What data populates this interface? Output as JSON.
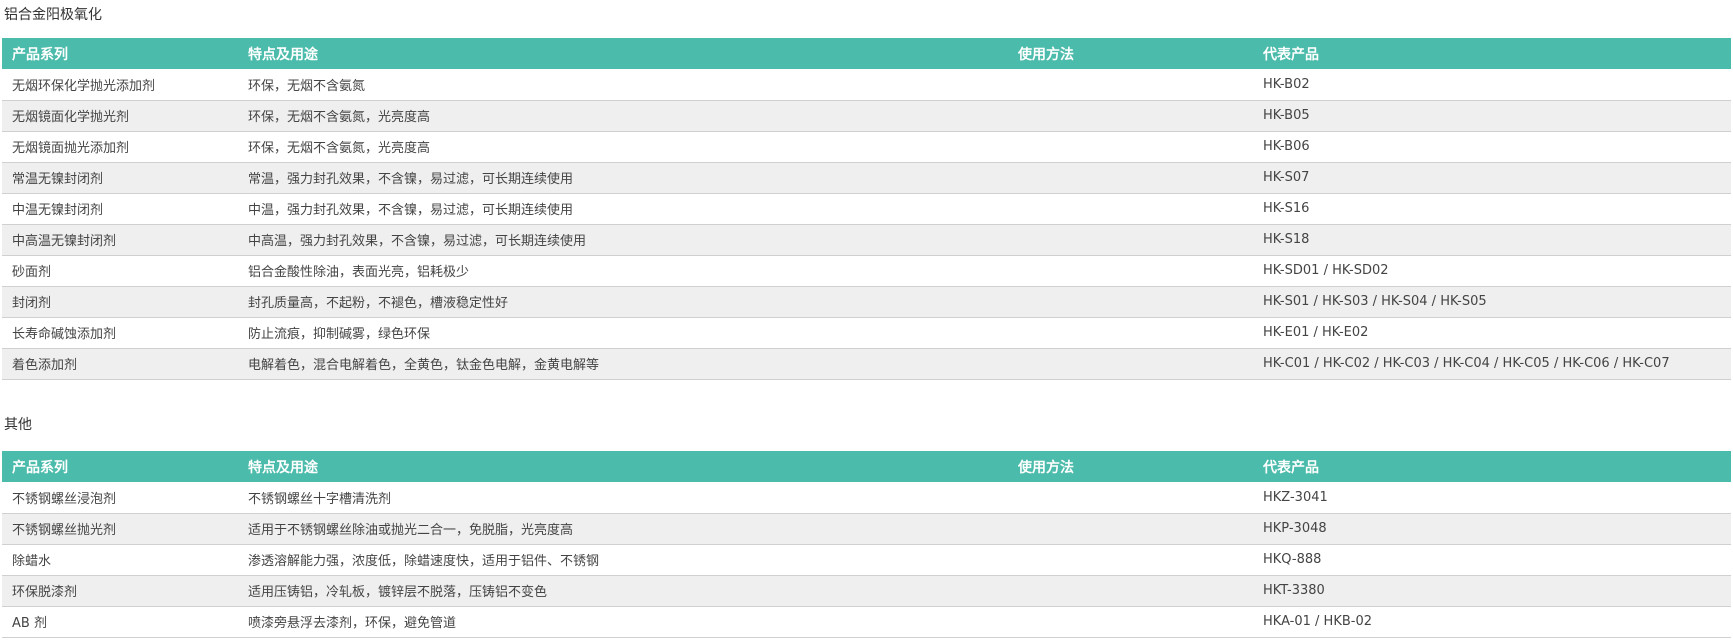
{
  "sections": [
    {
      "title": "铝合金阳极氧化",
      "headers": [
        "产品系列",
        "特点及用途",
        "使用方法",
        "代表产品"
      ],
      "rows": [
        {
          "series": "无烟环保化学抛光添加剂",
          "features": "环保，无烟不含氨氮",
          "usage": "",
          "product": "HK-B02"
        },
        {
          "series": "无烟镜面化学抛光剂",
          "features": "环保，无烟不含氨氮，光亮度高",
          "usage": "",
          "product": "HK-B05"
        },
        {
          "series": "无烟镜面抛光添加剂",
          "features": "环保，无烟不含氨氮，光亮度高",
          "usage": "",
          "product": "HK-B06"
        },
        {
          "series": "常温无镍封闭剂",
          "features": "常温，强力封孔效果，不含镍，易过滤，可长期连续使用",
          "usage": "",
          "product": "HK-S07"
        },
        {
          "series": "中温无镍封闭剂",
          "features": "中温，强力封孔效果，不含镍，易过滤，可长期连续使用",
          "usage": "",
          "product": "HK-S16"
        },
        {
          "series": "中高温无镍封闭剂",
          "features": "中高温，强力封孔效果，不含镍，易过滤，可长期连续使用",
          "usage": "",
          "product": "HK-S18"
        },
        {
          "series": "砂面剂",
          "features": "铝合金酸性除油，表面光亮，铝耗极少",
          "usage": "",
          "product": "HK-SD01 / HK-SD02"
        },
        {
          "series": "封闭剂",
          "features": "封孔质量高，不起粉，不褪色，槽液稳定性好",
          "usage": "",
          "product": "HK-S01 / HK-S03 / HK-S04 / HK-S05"
        },
        {
          "series": "长寿命碱蚀添加剂",
          "features": "防止流痕，抑制碱雾，绿色环保",
          "usage": "",
          "product": "HK-E01 / HK-E02"
        },
        {
          "series": "着色添加剂",
          "features": "电解着色，混合电解着色，全黄色，钛金色电解，金黄电解等",
          "usage": "",
          "product": "HK-C01 / HK-C02 / HK-C03 / HK-C04 / HK-C05 / HK-C06 / HK-C07"
        }
      ]
    },
    {
      "title": "其他",
      "headers": [
        "产品系列",
        "特点及用途",
        "使用方法",
        "代表产品"
      ],
      "rows": [
        {
          "series": "不锈钢螺丝浸泡剂",
          "features": "不锈钢螺丝十字槽清洗剂",
          "usage": "",
          "product": "HKZ-3041"
        },
        {
          "series": "不锈钢螺丝抛光剂",
          "features": "适用于不锈钢螺丝除油或抛光二合一，免脱脂，光亮度高",
          "usage": "",
          "product": "HKP-3048"
        },
        {
          "series": "除蜡水",
          "features": "渗透溶解能力强，浓度低，除蜡速度快，适用于铝件、不锈钢",
          "usage": "",
          "product": "HKQ-888"
        },
        {
          "series": "环保脱漆剂",
          "features": "适用压铸铝，冷轧板，镀锌层不脱落，压铸铝不变色",
          "usage": "",
          "product": "HKT-3380"
        },
        {
          "series": "AB 剂",
          "features": "喷漆旁悬浮去漆剂，环保，避免管道",
          "usage": "",
          "product": "HKA-01 / HKB-02"
        }
      ]
    }
  ],
  "colors": {
    "header_bg": "#4bbbab",
    "header_text": "#ffffff",
    "row_alt_bg": "#efefef",
    "row_border": "#d0d0d0"
  }
}
